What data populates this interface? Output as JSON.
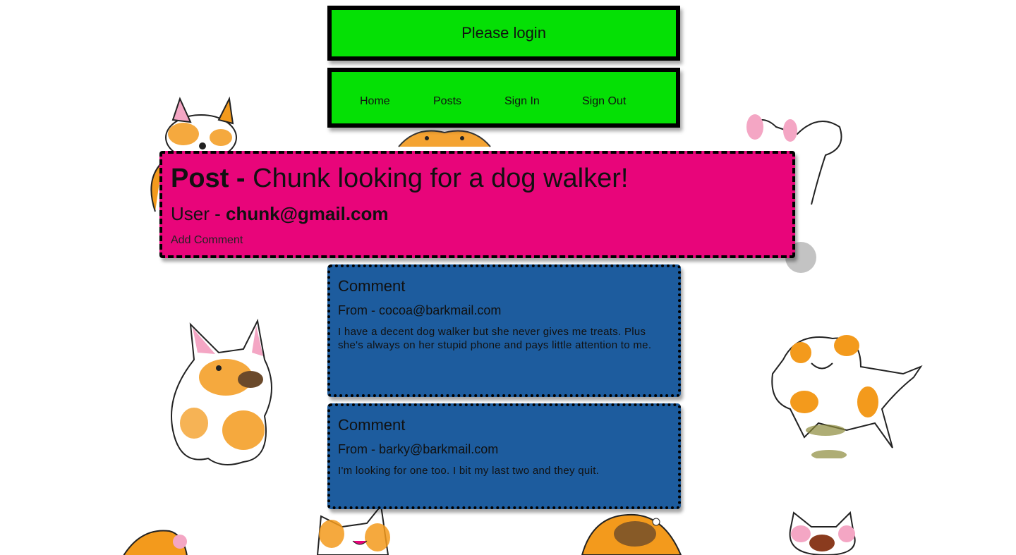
{
  "header": {
    "login_message": "Please login"
  },
  "nav": {
    "items": [
      {
        "label": "Home"
      },
      {
        "label": "Posts"
      },
      {
        "label": "Sign In"
      },
      {
        "label": "Sign Out"
      }
    ]
  },
  "post": {
    "prefix": "Post - ",
    "title": "Chunk looking for a dog walker!",
    "user_prefix": "User - ",
    "user_email": "chunk@gmail.com",
    "add_comment_label": "Add Comment"
  },
  "comments": [
    {
      "heading": "Comment",
      "from": "From - cocoa@barkmail.com",
      "body": "I have a decent dog walker but she never gives me treats. Plus she's always on her stupid phone and pays little attention to me."
    },
    {
      "heading": "Comment",
      "from": "From - barky@barkmail.com",
      "body": "I'm looking for one too. I bit my last two and they quit."
    }
  ],
  "colors": {
    "banner_green": "#05e005",
    "post_pink": "#e8057a",
    "comment_blue": "#1d5c9e",
    "dog_orange": "#f39a1c",
    "dog_pink": "#f4a6c4"
  }
}
